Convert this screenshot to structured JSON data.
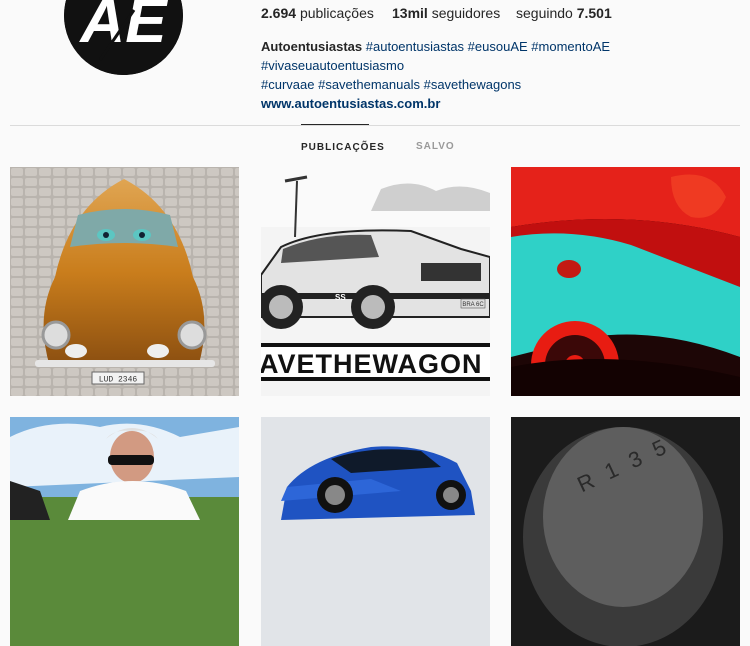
{
  "profile": {
    "avatar_text": "AE",
    "stats": {
      "posts_value": "2.694",
      "posts_label": "publicações",
      "followers_value": "13mil",
      "followers_label": "seguidores",
      "following_label": "seguindo",
      "following_value": "7.501"
    },
    "bio": {
      "name": "Autoentusiastas",
      "hashtags_line1": "#autoentusiastas #eusouAE #momentoAE #vivaseuautoentusiasmo",
      "hashtags_line2": "#curvaae #savethemanuals #savethewagons",
      "website": "www.autoentusiastas.com.br"
    }
  },
  "tabs": [
    {
      "label": "PUBLICAÇÕES",
      "active": true
    },
    {
      "label": "SALVO",
      "active": false
    }
  ],
  "posts": [
    {
      "subject": "orange-beetle-photo",
      "plate": "LUD 2346"
    },
    {
      "subject": "opala-wagon-bw-photo",
      "caption": "AVETHEWAGON",
      "badge": "SS",
      "plate": "BRA 6C"
    },
    {
      "subject": "red-cyan-car-art"
    },
    {
      "subject": "driver-portrait-photo"
    },
    {
      "subject": "blue-ford-focus-photo"
    },
    {
      "subject": "gear-shift-knob-photo",
      "engraving": "R 1 3 5"
    }
  ],
  "colors": {
    "link": "#003569",
    "tab_active": "#262626",
    "tab_inactive": "#999999",
    "divider": "#dbdbdb"
  }
}
